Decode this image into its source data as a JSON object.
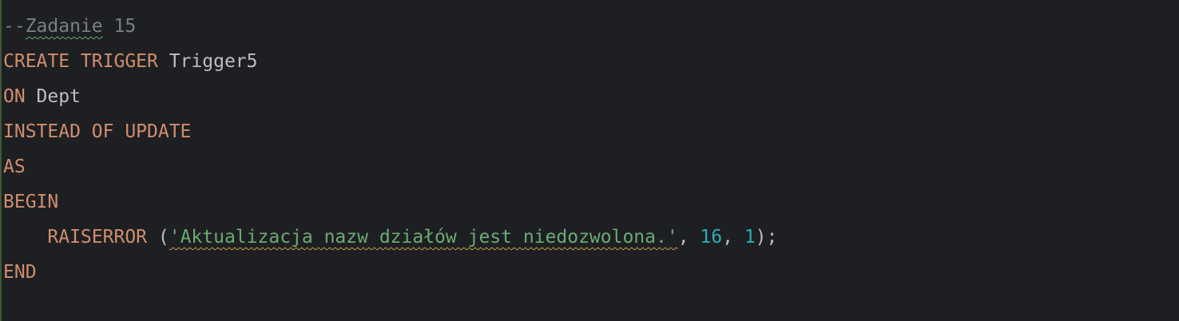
{
  "editor": {
    "language": "SQL",
    "colors": {
      "background": "#1e1f22",
      "keyword": "#cf8e6d",
      "identifier": "#bcbec4",
      "comment": "#7a7e85",
      "string": "#6aab73",
      "number": "#2aacb8"
    },
    "lines": [
      {
        "comment_prefix": "--",
        "comment_word": "Zadanie",
        "comment_rest": " 15"
      },
      {
        "kw1": "CREATE TRIGGER",
        "ident": " Trigger5"
      },
      {
        "kw1": "ON",
        "ident": " Dept"
      },
      {
        "kw1": "INSTEAD OF UPDATE"
      },
      {
        "kw1": "AS"
      },
      {
        "kw1": "BEGIN"
      },
      {
        "indent": "    ",
        "kw1": "RAISERROR",
        "open": " (",
        "string": "'Aktualizacja nazw działów jest niedozwolona.'",
        "sep1": ", ",
        "num1": "16",
        "sep2": ", ",
        "num2": "1",
        "close": ");"
      },
      {
        "kw1": "END"
      }
    ]
  }
}
